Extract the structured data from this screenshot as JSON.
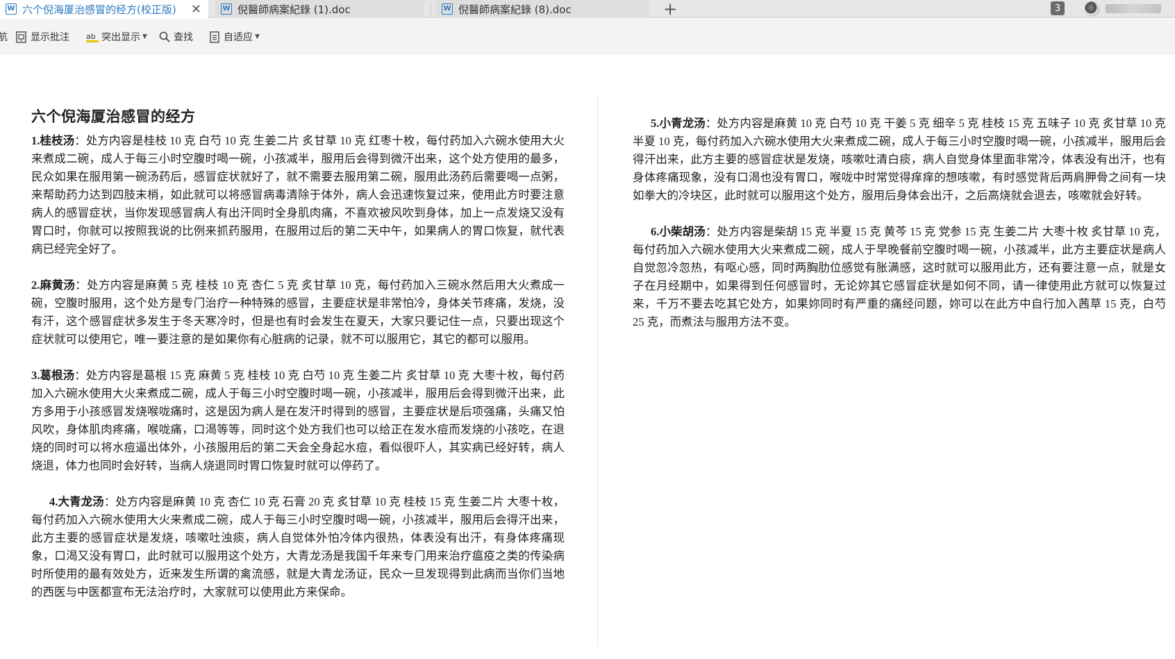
{
  "tabs": [
    {
      "label": "六个倪海厦治感冒的经方(校正版)",
      "active": true
    },
    {
      "label": "倪醫師病案紀錄 (1).doc",
      "active": false
    },
    {
      "label": "倪醫師病案紀錄 (8).doc",
      "active": false
    }
  ],
  "tab_icon_letter": "W",
  "tab_count_badge": "3",
  "toolbar": {
    "cut_label": "航",
    "show_comments": "显示批注",
    "highlight": "突出显示",
    "find": "查找",
    "fit": "自适应"
  },
  "document": {
    "title": "六个倪海厦治感冒的经方",
    "left_paragraphs": [
      {
        "name": "1.桂枝汤",
        "text": "：处方内容是桂枝 10 克 白芍 10 克 生姜二片 炙甘草 10 克 红枣十枚，每付药加入六碗水使用大火来煮成二碗，成人于每三小时空腹时喝一碗，小孩减半，服用后会得到微汗出来，这个处方使用的最多，民众如果在服用第一碗汤药后，感冒症状就好了，就不需要去服用第二碗，服用此汤药后需要喝一点粥，来帮助药力达到四肢末梢，如此就可以将感冒病毒清除于体外，病人会迅速恢复过来，使用此方时要注意病人的感冒症状，当你发现感冒病人有出汗同时全身肌肉痛，不喜欢被风吹到身体，加上一点发烧又没有胃口时，你就可以按照我说的比例来抓药服用，在服用过后的第二天中午，如果病人的胃口恢复，就代表病已经完全好了。"
      },
      {
        "name": "2.麻黄汤",
        "text": "：处方内容是麻黄 5 克 桂枝 10 克 杏仁 5 克 炙甘草 10 克，每付药加入三碗水然后用大火煮成一碗，空腹时服用，这个处方是专门治疗一种特殊的感冒，主要症状是非常怕冷，身体关节疼痛，发烧，没有汗，这个感冒症状多发生于冬天寒冷时，但是也有时会发生在夏天，大家只要记住一点，只要出现这个症状就可以使用它，唯一要注意的是如果你有心脏病的记录，就不可以服用它，其它的都可以服用。"
      },
      {
        "name": "3.葛根汤",
        "text": "：处方内容是葛根 15 克 麻黄 5 克 桂枝 10 克 白芍 10 克 生姜二片 炙甘草 10 克 大枣十枚，每付药加入六碗水使用大火来煮成二碗，成人于每三小时空腹时喝一碗，小孩减半，服用后会得到微汗出来，此方多用于小孩感冒发烧喉咙痛时，这是因为病人是在发汗时得到的感冒，主要症状是后项强痛，头痛又怕风吹，身体肌肉疼痛，喉咙痛，口渴等等，同时这个处方我们也可以给正在发水痘而发烧的小孩吃，在退烧的同时可以将水痘逼出体外，小孩服用后的第二天会全身起水痘，看似很吓人，其实病已经好转，病人烧退，体力也同时会好转，当病人烧退同时胃口恢复时就可以停药了。"
      },
      {
        "name": "4.大青龙汤",
        "text": "：处方内容是麻黄 10 克 杏仁 10 克 石膏 20 克 炙甘草 10 克 桂枝 15 克 生姜二片 大枣十枚，每付药加入六碗水使用大火来煮成二碗，成人于每三小时空腹时喝一碗，小孩减半，服用后会得汗出来，此方主要的感冒症状是发烧，咳嗽吐浊痰，病人自觉体外怕冷体内很热，体表没有出汗，有身体疼痛现象，口渴又没有胃口，此时就可以服用这个处方，大青龙汤是我国千年来专门用来治疗瘟疫之类的传染病时所使用的最有效处方，近来发生所谓的禽流感，就是大青龙汤证，民众一旦发现得到此病而当你们当地的西医与中医都宣布无法治疗时，大家就可以使用此方来保命。",
        "indent": true
      }
    ],
    "right_paragraphs": [
      {
        "name": "5.小青龙汤",
        "text": "：处方内容是麻黄 10 克 白芍 10 克 干姜 5 克 细辛 5 克 桂枝 15 克 五味子 10 克 炙甘草 10 克 半夏 10 克，每付药加入六碗水使用大火来煮成二碗，成人于每三小时空腹时喝一碗，小孩减半，服用后会得汗出来，此方主要的感冒症状是发烧，咳嗽吐清白痰，病人自觉身体里面非常冷，体表没有出汗，也有身体疼痛现象，没有口渴也没有胃口，喉咙中时常觉得痒痒的想咳嗽，有时感觉背后两肩胛骨之间有一块如拳大的冷块区，此时就可以服用这个处方，服用后身体会出汗，之后高烧就会退去，咳嗽就会好转。",
        "indent": true
      },
      {
        "name": "6.小柴胡汤",
        "text": "：处方内容是柴胡 15 克 半夏 15 克 黄芩 15 克 党参 15 克 生姜二片 大枣十枚 炙甘草 10 克，每付药加入六碗水使用大火来煮成二碗，成人于早晚餐前空腹时喝一碗，小孩减半，此方主要症状是病人自觉忽冷忽热，有呕心感，同时两胸肋位感觉有胀满感，这时就可以服用此方，还有要注意一点，就是女子在月经期中，如果得到任何感冒时，无论妳其它感冒症状是如何不同，请一律使用此方就可以恢复过来，千万不要去吃其它处方，如果妳同时有严重的痛经问题，妳可以在此方中自行加入茜草 15 克，白芍 25 克，而煮法与服用方法不变。",
        "indent": true
      }
    ]
  }
}
